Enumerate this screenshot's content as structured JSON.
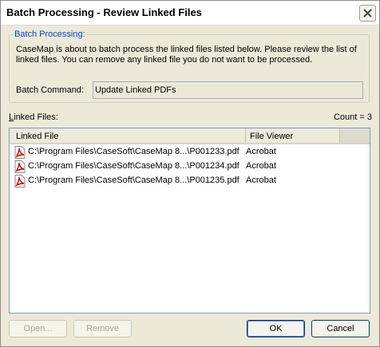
{
  "window": {
    "title": "Batch Processing - Review Linked Files"
  },
  "group": {
    "legend": "Batch Processing:",
    "description": "CaseMap is about to batch process the linked files listed below.  Please review the list of linked files.  You can remove any linked file you do not want to be processed."
  },
  "batch_command": {
    "label": "Batch Command:",
    "value": "Update Linked PDFs"
  },
  "linked_files": {
    "label_prefix": "L",
    "label_rest": "inked Files:",
    "count": "Count = 3",
    "columns": [
      "Linked File",
      "File Viewer"
    ],
    "rows": [
      {
        "path": "C:\\Program Files\\CaseSoft\\CaseMap 8...\\P001233.pdf",
        "viewer": "Acrobat",
        "icon": "pdf-icon"
      },
      {
        "path": "C:\\Program Files\\CaseSoft\\CaseMap 8...\\P001234.pdf",
        "viewer": "Acrobat",
        "icon": "pdf-icon"
      },
      {
        "path": "C:\\Program Files\\CaseSoft\\CaseMap 8...\\P001235.pdf",
        "viewer": "Acrobat",
        "icon": "pdf-icon"
      }
    ]
  },
  "buttons": {
    "open": "Open...",
    "remove": "Remove",
    "ok": "OK",
    "cancel": "Cancel"
  },
  "colors": {
    "dialog_bg": "#ece9d8",
    "legend_text": "#0046d5",
    "pdf_red": "#d10000"
  }
}
